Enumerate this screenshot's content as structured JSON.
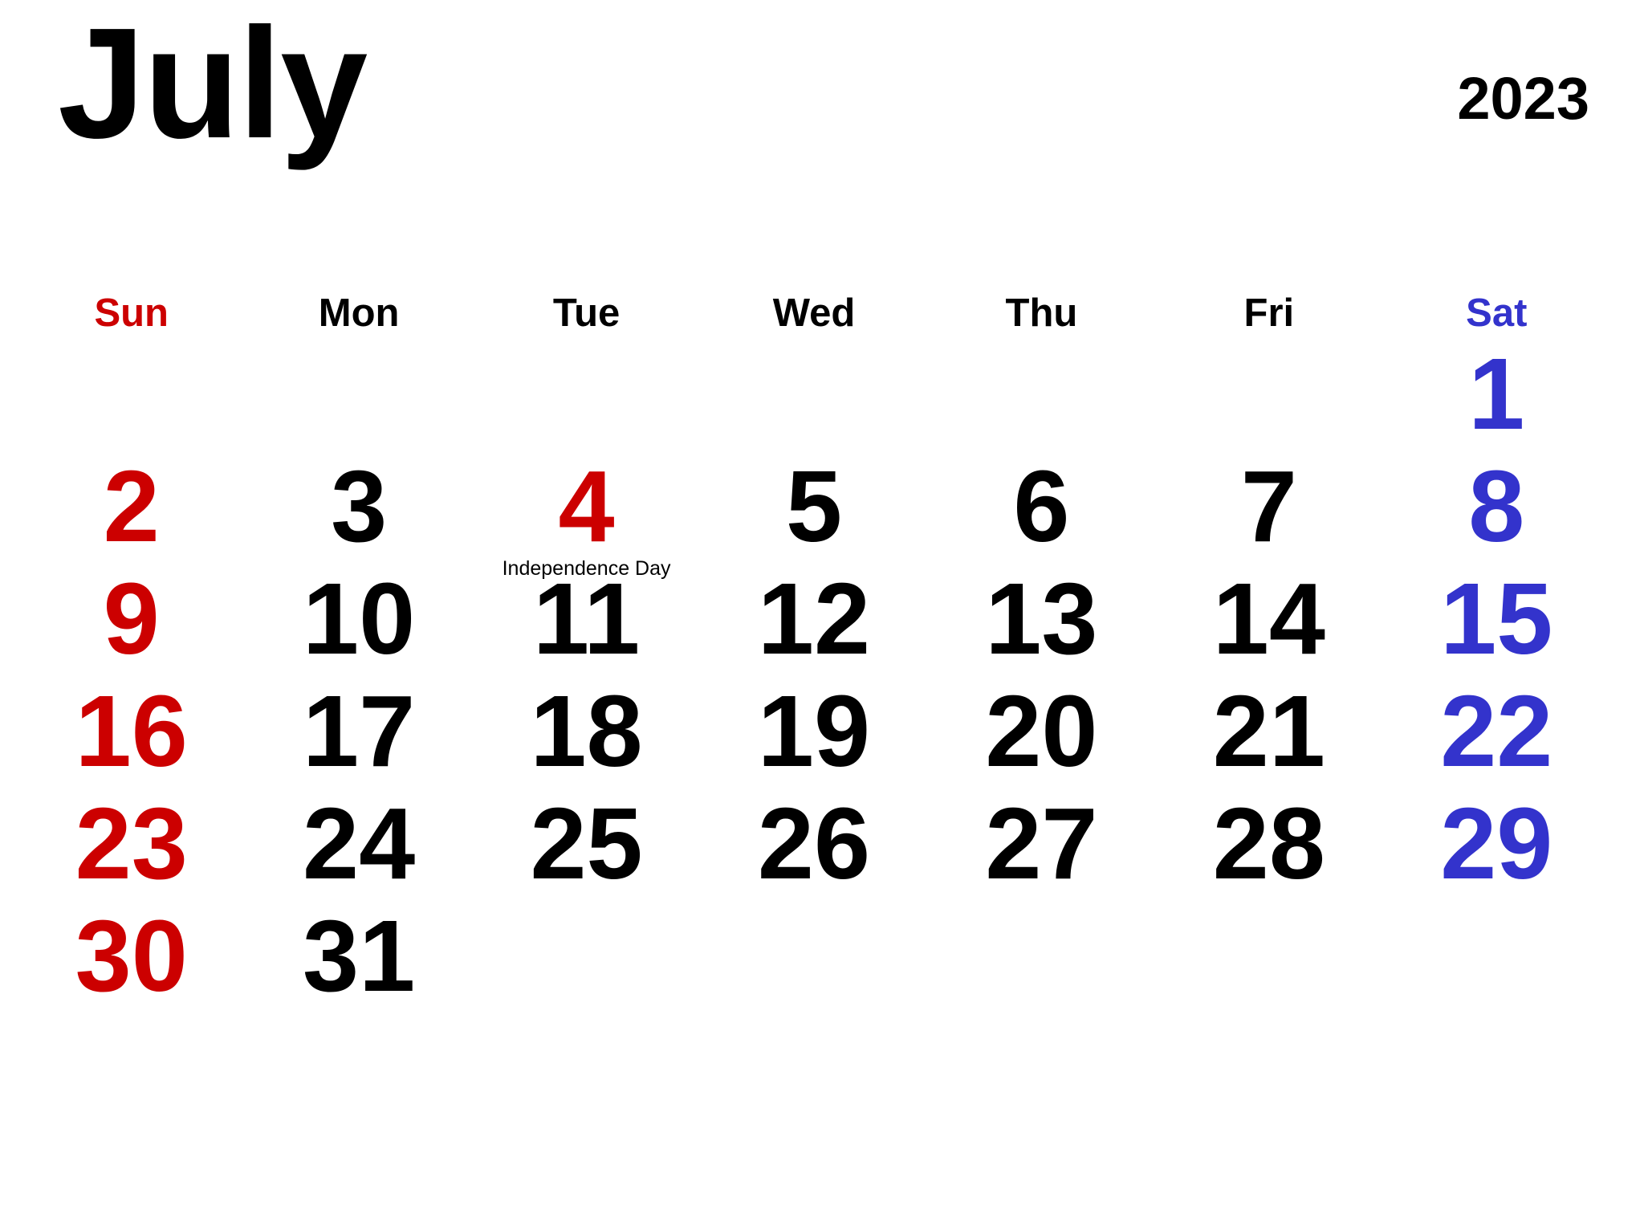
{
  "header": {
    "month": "July",
    "year": "2023"
  },
  "colors": {
    "sunday": "#CC0000",
    "saturday": "#3333CC",
    "weekday": "#000000",
    "holiday": "#CC0000",
    "background": "#FFFFFF"
  },
  "weekdays": [
    {
      "label": "Sun",
      "kind": "sunday"
    },
    {
      "label": "Mon",
      "kind": "weekday"
    },
    {
      "label": "Tue",
      "kind": "weekday"
    },
    {
      "label": "Wed",
      "kind": "weekday"
    },
    {
      "label": "Thu",
      "kind": "weekday"
    },
    {
      "label": "Fri",
      "kind": "weekday"
    },
    {
      "label": "Sat",
      "kind": "saturday"
    }
  ],
  "weeks": [
    [
      {
        "day": "",
        "kind": "empty",
        "event": ""
      },
      {
        "day": "",
        "kind": "empty",
        "event": ""
      },
      {
        "day": "",
        "kind": "empty",
        "event": ""
      },
      {
        "day": "",
        "kind": "empty",
        "event": ""
      },
      {
        "day": "",
        "kind": "empty",
        "event": ""
      },
      {
        "day": "",
        "kind": "empty",
        "event": ""
      },
      {
        "day": "1",
        "kind": "saturday",
        "event": ""
      }
    ],
    [
      {
        "day": "2",
        "kind": "sunday",
        "event": ""
      },
      {
        "day": "3",
        "kind": "weekday",
        "event": ""
      },
      {
        "day": "4",
        "kind": "holiday",
        "event": "Independence Day"
      },
      {
        "day": "5",
        "kind": "weekday",
        "event": ""
      },
      {
        "day": "6",
        "kind": "weekday",
        "event": ""
      },
      {
        "day": "7",
        "kind": "weekday",
        "event": ""
      },
      {
        "day": "8",
        "kind": "saturday",
        "event": ""
      }
    ],
    [
      {
        "day": "9",
        "kind": "sunday",
        "event": ""
      },
      {
        "day": "10",
        "kind": "weekday",
        "event": ""
      },
      {
        "day": "11",
        "kind": "weekday",
        "event": ""
      },
      {
        "day": "12",
        "kind": "weekday",
        "event": ""
      },
      {
        "day": "13",
        "kind": "weekday",
        "event": ""
      },
      {
        "day": "14",
        "kind": "weekday",
        "event": ""
      },
      {
        "day": "15",
        "kind": "saturday",
        "event": ""
      }
    ],
    [
      {
        "day": "16",
        "kind": "sunday",
        "event": ""
      },
      {
        "day": "17",
        "kind": "weekday",
        "event": ""
      },
      {
        "day": "18",
        "kind": "weekday",
        "event": ""
      },
      {
        "day": "19",
        "kind": "weekday",
        "event": ""
      },
      {
        "day": "20",
        "kind": "weekday",
        "event": ""
      },
      {
        "day": "21",
        "kind": "weekday",
        "event": ""
      },
      {
        "day": "22",
        "kind": "saturday",
        "event": ""
      }
    ],
    [
      {
        "day": "23",
        "kind": "sunday",
        "event": ""
      },
      {
        "day": "24",
        "kind": "weekday",
        "event": ""
      },
      {
        "day": "25",
        "kind": "weekday",
        "event": ""
      },
      {
        "day": "26",
        "kind": "weekday",
        "event": ""
      },
      {
        "day": "27",
        "kind": "weekday",
        "event": ""
      },
      {
        "day": "28",
        "kind": "weekday",
        "event": ""
      },
      {
        "day": "29",
        "kind": "saturday",
        "event": ""
      }
    ],
    [
      {
        "day": "30",
        "kind": "sunday",
        "event": ""
      },
      {
        "day": "31",
        "kind": "weekday",
        "event": ""
      },
      {
        "day": "",
        "kind": "empty",
        "event": ""
      },
      {
        "day": "",
        "kind": "empty",
        "event": ""
      },
      {
        "day": "",
        "kind": "empty",
        "event": ""
      },
      {
        "day": "",
        "kind": "empty",
        "event": ""
      },
      {
        "day": "",
        "kind": "empty",
        "event": ""
      }
    ]
  ]
}
